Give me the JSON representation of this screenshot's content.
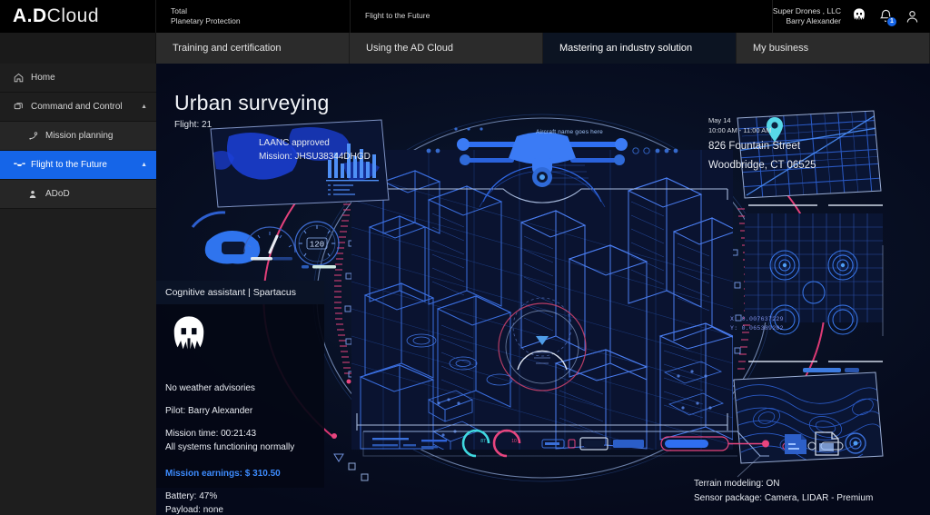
{
  "brand": {
    "bold": "A.D",
    "light": "Cloud"
  },
  "header": {
    "segment1": {
      "line1": "Total",
      "line2": "Planetary Protection"
    },
    "segment2": {
      "line1": "Flight to the Future"
    },
    "account": {
      "company": "Super Drones , LLC",
      "user": "Barry Alexander"
    },
    "icons": {
      "helmet": "spartan-helmet-icon",
      "bell": "notification-bell-icon",
      "user": "user-avatar-icon"
    },
    "notification_count": "1"
  },
  "tabs": [
    {
      "label": "Training and certification",
      "active": false
    },
    {
      "label": "Using the AD Cloud",
      "active": false
    },
    {
      "label": "Mastering an industry solution",
      "active": true
    },
    {
      "label": "My business",
      "active": false
    }
  ],
  "sidebar": {
    "items": [
      {
        "label": "Home",
        "icon": "home-icon",
        "level": 0,
        "active": false,
        "chevron": ""
      },
      {
        "label": "Command and Control",
        "icon": "layers-icon",
        "level": 0,
        "active": false,
        "chevron": "▲"
      },
      {
        "label": "Mission planning",
        "icon": "route-icon",
        "level": 1,
        "active": false,
        "chevron": ""
      },
      {
        "label": "Flight to the Future",
        "icon": "drone-icon",
        "level": 0,
        "active": true,
        "chevron": "▲"
      },
      {
        "label": "ADoD",
        "icon": "person-icon",
        "level": 1,
        "active": false,
        "chevron": ""
      }
    ]
  },
  "mission": {
    "title": "Urban surveying",
    "flight": "Flight: 21",
    "laanc": "LAANC approved",
    "mission_id": "Mission: JHSU38344DHGD",
    "aircraft_name": "Aircraft name goes here",
    "date": "May 14",
    "time_window": "10:00 AM - 11:00 AM",
    "address_line1": "826 Fountain Street",
    "address_line2": "Woodbridge, CT 06525",
    "terrain_modeling": "Terrain modeling: ON",
    "sensor_package": "Sensor package: Camera, LIDAR - Premium",
    "coord_x": "X: 0.007637229",
    "coord_y": "Y: 0.065389202",
    "speed_readout": "120"
  },
  "cognitive_assistant": {
    "header": "Cognitive assistant | Spartacus",
    "avatar_icon": "spartan-helmet-icon",
    "weather": "No weather advisories",
    "pilot": "Pilot: Barry Alexander",
    "mission_time": "Mission time: 00:21:43",
    "systems": "All systems functioning normally",
    "earnings": "Mission earnings: $ 310.50",
    "battery": "Battery: 47%",
    "payload": "Payload: none"
  },
  "colors": {
    "accent_blue": "#1565e8",
    "hud_blue": "#2e6df2",
    "hud_cyan": "#3fd8e0",
    "hud_pink": "#e8457f",
    "bg_dark": "#05091a",
    "panel_dark": "#1e1e1e"
  }
}
